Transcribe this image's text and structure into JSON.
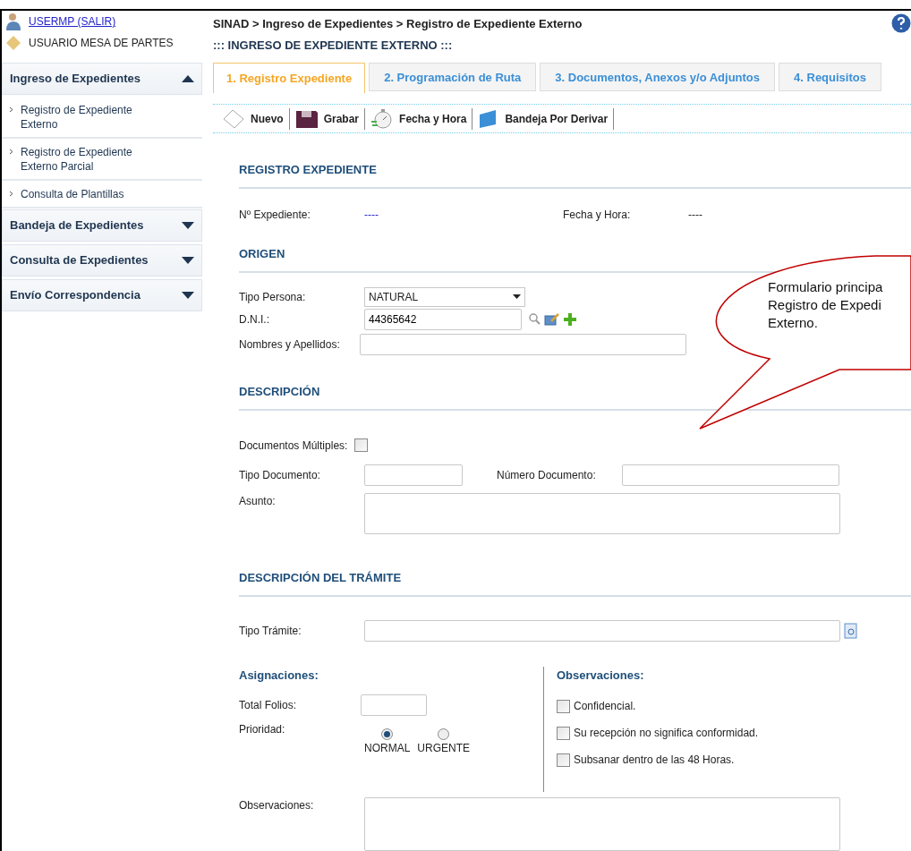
{
  "user": {
    "link": "USERMP (SALIR)",
    "role": "USUARIO MESA DE PARTES"
  },
  "sidebar": {
    "groups": [
      {
        "label": "Ingreso de Expedientes",
        "expanded": true,
        "items": [
          "Registro de Expediente Externo",
          "Registro de Expediente Externo Parcial",
          "Consulta de Plantillas"
        ]
      },
      {
        "label": "Bandeja de Expedientes",
        "expanded": false
      },
      {
        "label": "Consulta de Expedientes",
        "expanded": false
      },
      {
        "label": "Envío Correspondencia",
        "expanded": false
      }
    ]
  },
  "breadcrumb": "SINAD > Ingreso de Expedientes > Registro de Expediente Externo",
  "page_title": "::: INGRESO DE EXPEDIENTE EXTERNO :::",
  "tabs": [
    {
      "label": "1. Registro Expediente",
      "selected": true
    },
    {
      "label": "2. Programación de Ruta",
      "selected": false
    },
    {
      "label": "3. Documentos, Anexos y/o Adjuntos",
      "selected": false
    },
    {
      "label": "4. Requisitos",
      "selected": false
    }
  ],
  "toolbar": [
    {
      "label": "Nuevo",
      "kind": "new"
    },
    {
      "label": "Grabar",
      "kind": "save"
    },
    {
      "label": "Fecha y Hora",
      "kind": "clock"
    },
    {
      "label": "Bandeja Por Derivar",
      "kind": "tray"
    }
  ],
  "registro": {
    "heading": "REGISTRO EXPEDIENTE",
    "fields": [
      {
        "label": "Nº Expediente:",
        "value": "----",
        "kind": "link"
      },
      {
        "label": "Fecha y Hora:",
        "value": "----",
        "kind": "text"
      }
    ]
  },
  "origen": {
    "heading": "ORIGEN",
    "tipo_persona": {
      "label": "Tipo Persona:",
      "value": "NATURAL"
    },
    "dni": {
      "label": "D.N.I.:",
      "value": "44365642"
    },
    "nombres": {
      "label": "Nombres y Apellidos:"
    }
  },
  "descripcion": {
    "heading": "DESCRIPCIÓN",
    "documentos_multiples": {
      "label": "Documentos Múltiples:",
      "checked": false
    },
    "tipo_documento": {
      "label": "Tipo Documento:"
    },
    "numero_documento": {
      "label": "Número Documento:"
    },
    "asunto": {
      "label": "Asunto:"
    }
  },
  "tramite": {
    "heading": "DESCRIPCIÓN DEL TRÁMITE",
    "tipo_tramite": {
      "label": "Tipo Trámite:"
    },
    "asignaciones": {
      "heading": "Asignaciones:",
      "total_folios": {
        "label": "Total Folios:"
      },
      "prioridad": {
        "label": "Prioridad:",
        "options": [
          {
            "label": "NORMAL",
            "selected": true
          },
          {
            "label": "URGENTE",
            "selected": false
          }
        ]
      }
    },
    "observaciones_checks": {
      "heading": "Observaciones:",
      "items": [
        {
          "label": "Confidencial.",
          "checked": false
        },
        {
          "label": "Su recepción no significa conformidad.",
          "checked": false
        },
        {
          "label": "Subsanar dentro de las 48 Horas.",
          "checked": false
        }
      ]
    },
    "observaciones": {
      "label": "Observaciones:"
    }
  },
  "callout": {
    "lines": [
      "Formulario principa",
      "Registro de Expedi",
      "Externo."
    ]
  }
}
